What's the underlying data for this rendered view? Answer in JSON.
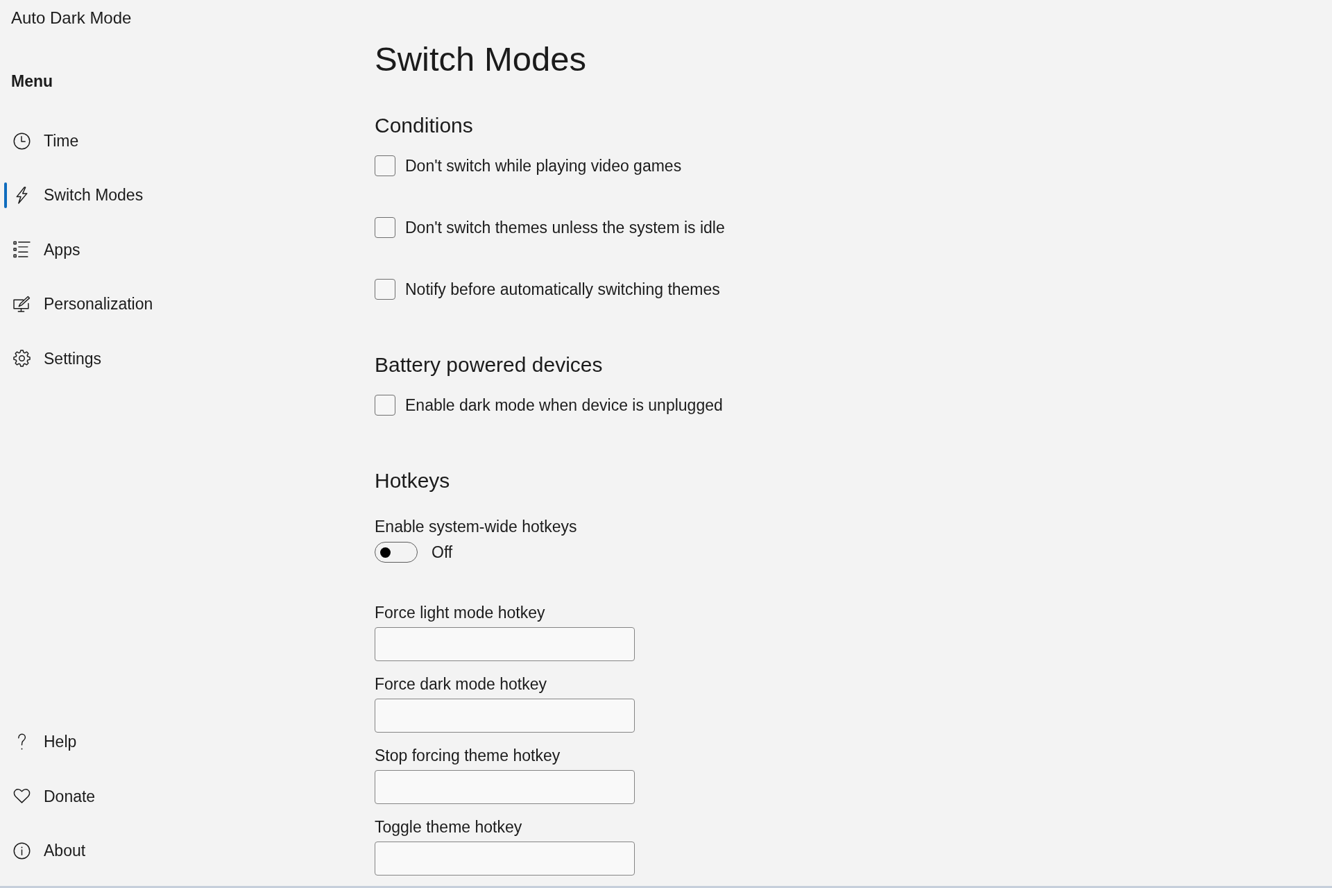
{
  "window": {
    "title": "Auto Dark Mode"
  },
  "sidebar": {
    "heading": "Menu",
    "items": [
      {
        "label": "Time",
        "selected": false
      },
      {
        "label": "Switch Modes",
        "selected": true
      },
      {
        "label": "Apps",
        "selected": false
      },
      {
        "label": "Personalization",
        "selected": false
      },
      {
        "label": "Settings",
        "selected": false
      }
    ],
    "footer_items": [
      {
        "label": "Help",
        "selected": false
      },
      {
        "label": "Donate",
        "selected": false
      },
      {
        "label": "About",
        "selected": false
      }
    ]
  },
  "page": {
    "title": "Switch Modes",
    "sections": [
      {
        "kind": "checkboxes",
        "heading": "Conditions",
        "options": [
          {
            "label": "Don't switch while playing video games",
            "checked": false
          },
          {
            "label": "Don't switch themes unless the system is idle",
            "checked": false
          },
          {
            "label": "Notify before automatically switching themes",
            "checked": false
          }
        ]
      },
      {
        "kind": "checkboxes",
        "heading": "Battery powered devices",
        "options": [
          {
            "label": "Enable dark mode when device is unplugged",
            "checked": false
          }
        ]
      },
      {
        "kind": "hotkeys",
        "heading": "Hotkeys",
        "toggle": {
          "label": "Enable system-wide hotkeys",
          "on": false,
          "state_text": "Off"
        },
        "fields": [
          {
            "label": "Force light mode hotkey"
          },
          {
            "label": "Force dark mode hotkey"
          },
          {
            "label": "Stop forcing theme hotkey"
          },
          {
            "label": "Toggle theme hotkey"
          }
        ]
      }
    ]
  }
}
